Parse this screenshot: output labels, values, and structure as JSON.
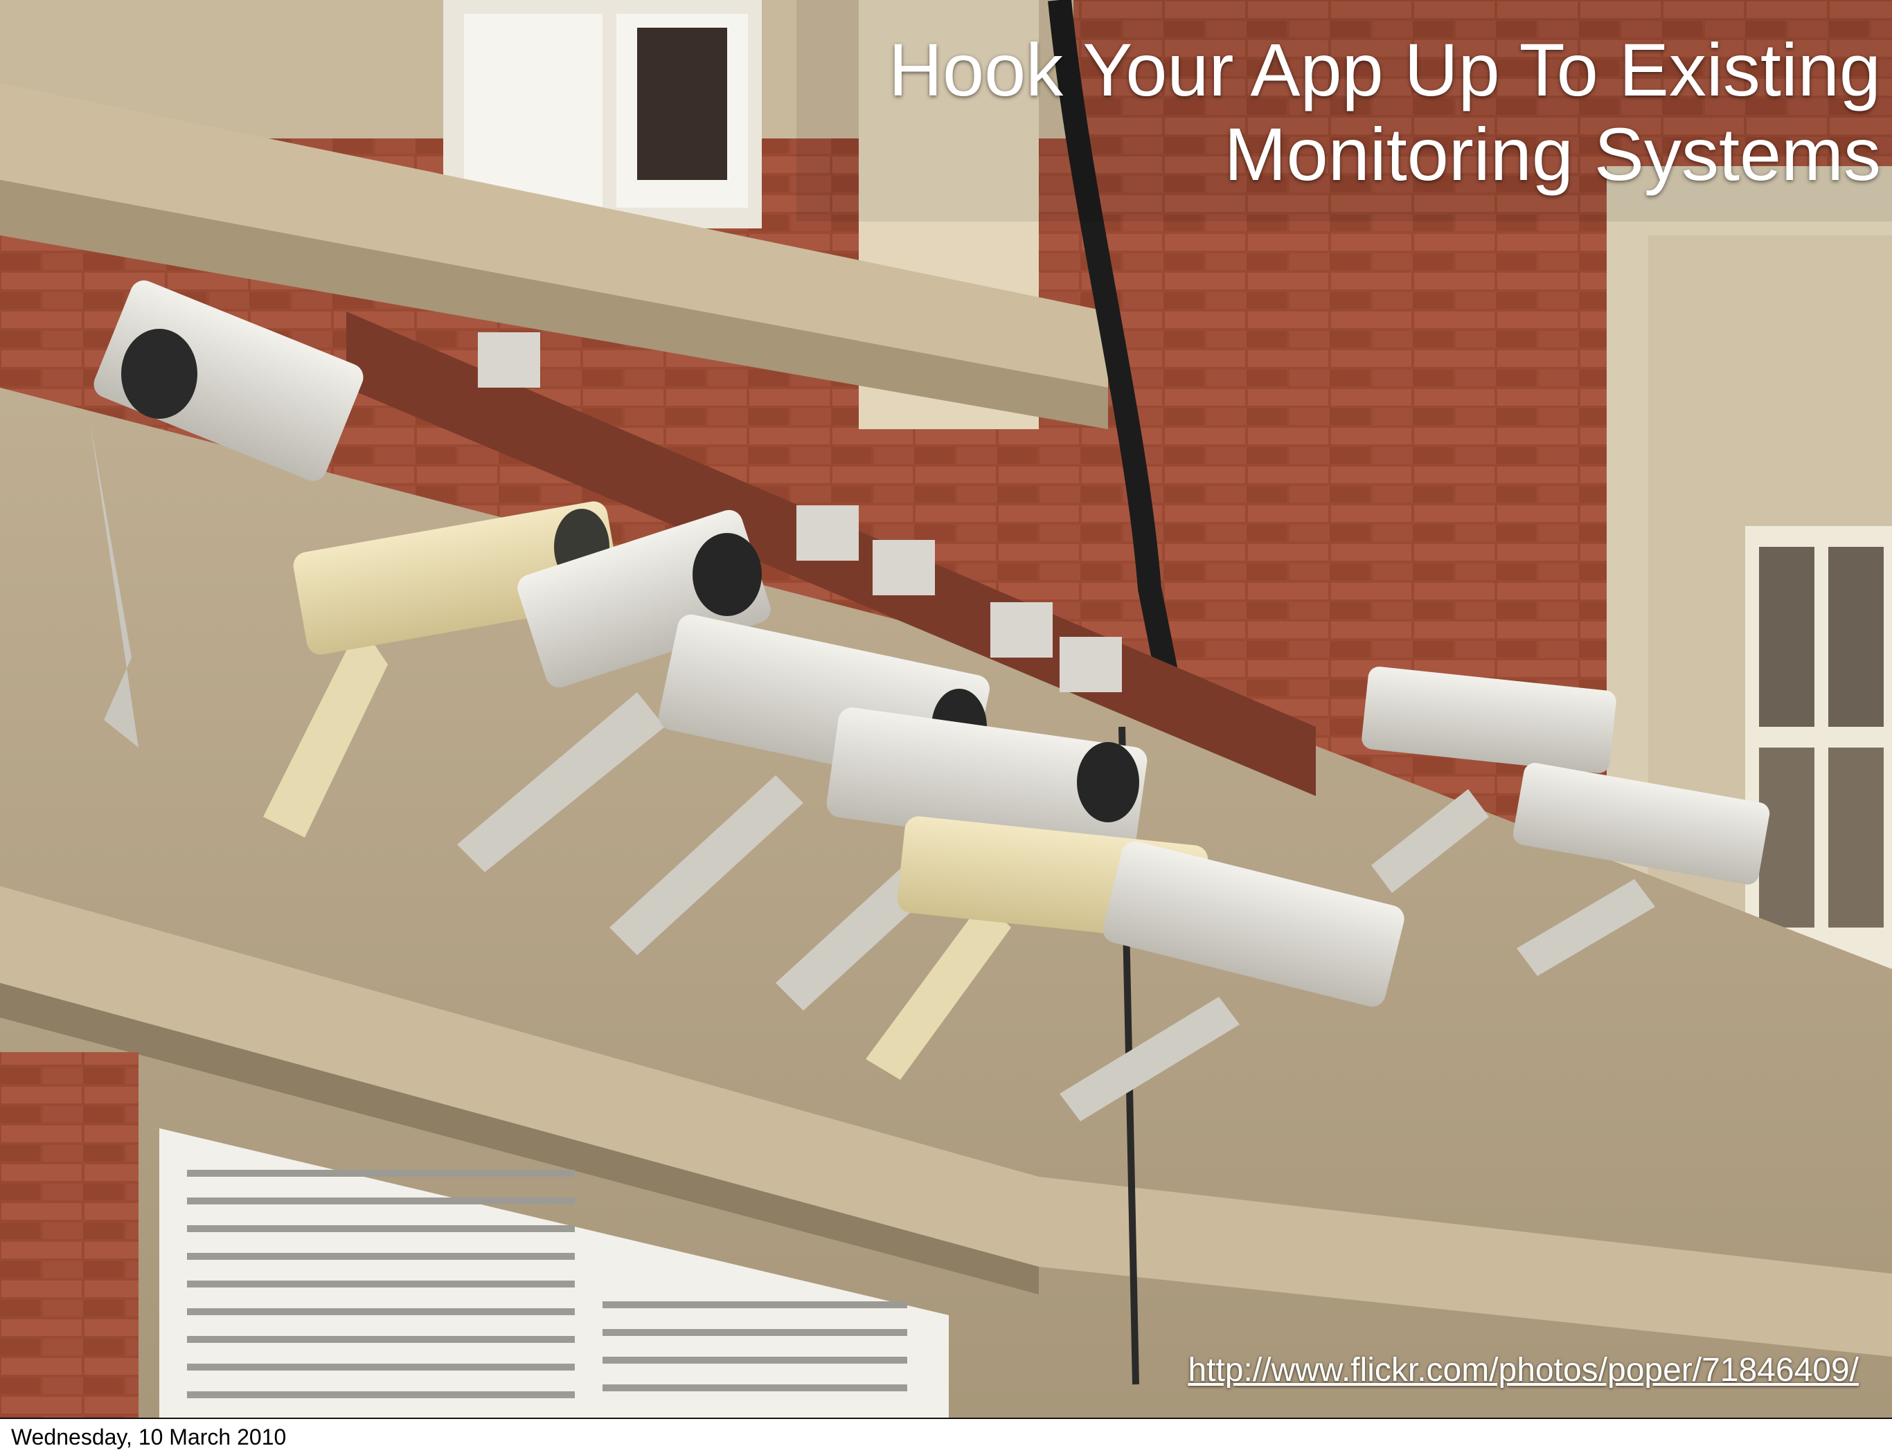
{
  "slide": {
    "title": "Hook Your App Up To Existing\nMonitoring Systems",
    "photo_credit": "http://www.flickr.com/photos/poper/71846409/",
    "photo_subject": "cluster of CCTV security cameras on brick and stone building"
  },
  "footer": {
    "date": "Wednesday, 10 March 2010"
  },
  "colors": {
    "brick": "#9a4a32",
    "stone": "#c9b99c",
    "camera_white": "#e4e2dc",
    "camera_cream": "#e8dcb0",
    "title_text": "#ffffff"
  }
}
